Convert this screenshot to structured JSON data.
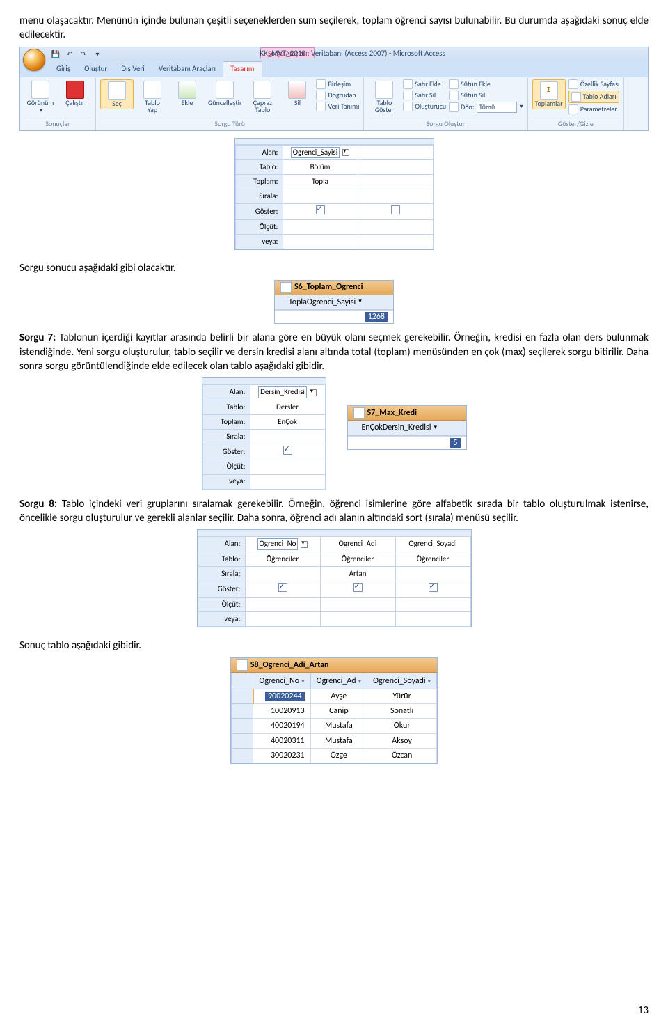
{
  "para1": "menu olaşacaktır. Menünün içinde bulunan çeşitli seçeneklerden sum seçilerek, toplam öğrenci sayısı bulunabilir. Bu durumda aşağıdaki sonuç elde edilecektir.",
  "ribbon": {
    "title": "KK_MVT_2010 : Veritabanı (Access 2007) - Microsoft Access",
    "context_tab": "Sorgu Araçları",
    "tabs": {
      "t1": "Giriş",
      "t2": "Oluştur",
      "t3": "Dış Veri",
      "t4": "Veritabanı Araçları",
      "t5": "Tasarım"
    },
    "btn": {
      "gorunum": "Görünüm",
      "calistir": "Çalıştır",
      "sec": "Seç",
      "tabloyap": "Tablo\nYap",
      "ekle": "Ekle",
      "guncellestir": "Güncelleştir",
      "capraz": "Çapraz\nTablo",
      "sil": "Sil",
      "birlesim": "Birleşim",
      "dogrudan": "Doğrudan",
      "veritanimi": "Veri Tanımı",
      "tablogoster": "Tablo\nGöster",
      "satirekle": "Satır Ekle",
      "satirsil": "Satır Sil",
      "olusturucu": "Oluşturucu",
      "sutunekle": "Sütun Ekle",
      "sutunsil": "Sütun Sil",
      "don": "Dön:",
      "don_val": "Tümü",
      "toplamlar": "Toplamlar",
      "ozellik": "Özellik Sayfası",
      "tabload": "Tablo Adları",
      "param": "Parametreler"
    },
    "group": {
      "sonuclar": "Sonuçlar",
      "sorguturu": "Sorgu Türü",
      "sorguolustur": "Sorgu Oluştur",
      "gostergizle": "Göster/Gizle"
    }
  },
  "gridlabels": {
    "alan": "Alan:",
    "tablo": "Tablo:",
    "toplam": "Toplam:",
    "sirala": "Sırala:",
    "goster": "Göster:",
    "olcut": "Ölçüt:",
    "veya": "veya:"
  },
  "grid1": {
    "alan": "Ogrenci_Sayisi",
    "tablo": "Bölüm",
    "toplam": "Topla"
  },
  "para2": "Sorgu sonucu aşağıdaki gibi olacaktır.",
  "ds1": {
    "tab": "S6_Toplam_Ogrenci",
    "col": "ToplaOgrenci_Sayisi",
    "val": "1268"
  },
  "sorgu7": {
    "title": "Sorgu 7: ",
    "body": "Tablonun içerdiği kayıtlar arasında belirli bir alana göre en büyük olanı seçmek gerekebilir. Örneğin, kredisi en fazla olan ders bulunmak istendiğinde. Yeni sorgu oluşturulur, tablo seçilir ve dersin kredisi alanı altında total (toplam) menüsünden en çok (max) seçilerek sorgu bitirilir. Daha sonra sorgu görüntülendiğinde elde edilecek olan tablo aşağıdaki gibidir."
  },
  "grid2": {
    "alan": "Dersin_Kredisi",
    "tablo": "Dersler",
    "toplam": "EnÇok"
  },
  "ds2": {
    "tab": "S7_Max_Kredi",
    "col": "EnÇokDersin_Kredisi",
    "val": "5"
  },
  "sorgu8": {
    "title": "Sorgu 8: ",
    "body": "Tablo içindeki veri gruplarını sıralamak gerekebilir. Örneğin, öğrenci isimlerine göre alfabetik sırada bir tablo oluşturulmak istenirse, öncelikle sorgu oluşturulur ve gerekli alanlar seçilir. Daha sonra, öğrenci adı alanın altındaki sort (sırala) menüsü seçilir."
  },
  "grid3": {
    "c1": {
      "alan": "Ogrenci_No",
      "tablo": "Öğrenciler",
      "sirala": ""
    },
    "c2": {
      "alan": "Ogrenci_Adi",
      "tablo": "Öğrenciler",
      "sirala": "Artan"
    },
    "c3": {
      "alan": "Ogrenci_Soyadi",
      "tablo": "Öğrenciler",
      "sirala": ""
    }
  },
  "para3": "Sonuç tablo aşağıdaki gibidir.",
  "ds3": {
    "tab": "S8_Ogrenci_Adi_Artan",
    "h1": "Ogrenci_No",
    "h2": "Ogrenci_Ad",
    "h3": "Ogrenci_Soyadi",
    "r1": {
      "a": "90020244",
      "b": "Ayşe",
      "c": "Yürür"
    },
    "r2": {
      "a": "10020913",
      "b": "Canip",
      "c": "Sonatlı"
    },
    "r3": {
      "a": "40020194",
      "b": "Mustafa",
      "c": "Okur"
    },
    "r4": {
      "a": "40020311",
      "b": "Mustafa",
      "c": "Aksoy"
    },
    "r5": {
      "a": "30020231",
      "b": "Özge",
      "c": "Özcan"
    }
  },
  "pageno": "13"
}
